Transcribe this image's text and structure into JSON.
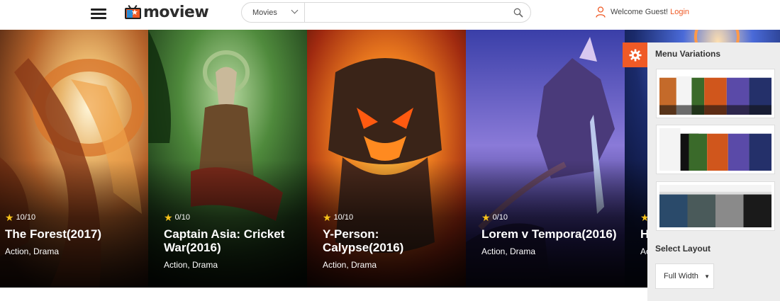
{
  "header": {
    "logo_text": "moview",
    "search": {
      "category": "Movies",
      "placeholder": ""
    },
    "user": {
      "welcome": "Welcome Guest!",
      "login": "Login"
    }
  },
  "movies": [
    {
      "rating": "10/10",
      "title": "The Forest(2017)",
      "genres": "Action, Drama"
    },
    {
      "rating": "0/10",
      "title": "Captain Asia: Cricket War(2016)",
      "genres": "Action, Drama"
    },
    {
      "rating": "10/10",
      "title": "Y-Person: Calypse(2016)",
      "genres": "Action, Drama"
    },
    {
      "rating": "0/10",
      "title": "Lorem v Tempora(2016)",
      "genres": "Action, Drama"
    },
    {
      "rating": "",
      "title": "H",
      "genres": "Ac"
    }
  ],
  "settings": {
    "menu_variations_heading": "Menu Variations",
    "select_layout_heading": "Select Layout",
    "layout_value": "Full Width"
  },
  "colors": {
    "accent": "#ef5a26",
    "star": "#f7c21a",
    "panel_bg": "#ededed"
  },
  "icons": {
    "menu": "hamburger-icon",
    "search": "search-icon",
    "user": "user-icon",
    "settings": "gear-icon",
    "rating": "star-icon"
  }
}
